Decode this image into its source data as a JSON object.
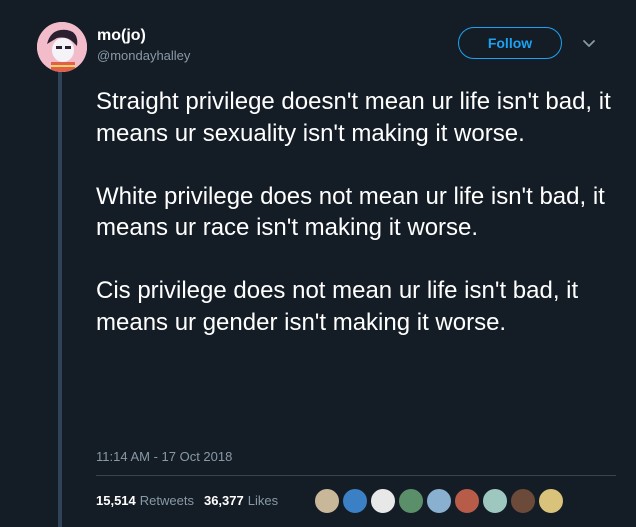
{
  "author": {
    "display_name": "mo(jo)",
    "handle": "@mondayhalley"
  },
  "follow_label": "Follow",
  "tweet": {
    "paragraphs": [
      "Straight privilege doesn't mean ur life isn't bad, it means ur sexuality isn't making it worse.",
      "White privilege does not mean ur life isn't bad, it means ur race isn't making it worse.",
      "Cis privilege does not mean ur life isn't bad, it means ur gender isn't making it worse."
    ],
    "timestamp": "11:14 AM - 17 Oct 2018"
  },
  "stats": {
    "retweets_count": "15,514",
    "retweets_label": "Retweets",
    "likes_count": "36,377",
    "likes_label": "Likes"
  },
  "likers": [
    {
      "color": "#c9b79a"
    },
    {
      "color": "#3b7fc4"
    },
    {
      "color": "#e8e8e8"
    },
    {
      "color": "#5a8f6a"
    },
    {
      "color": "#8ab0cf"
    },
    {
      "color": "#b85c4a"
    },
    {
      "color": "#9ec7c0"
    },
    {
      "color": "#6b4a3a"
    },
    {
      "color": "#d9c27a"
    }
  ]
}
